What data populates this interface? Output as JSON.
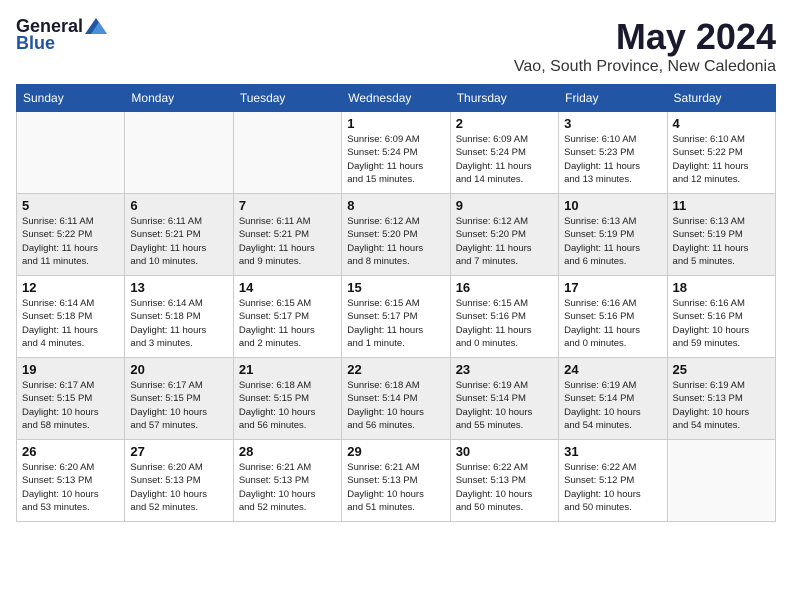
{
  "header": {
    "logo_general": "General",
    "logo_blue": "Blue",
    "month_year": "May 2024",
    "location": "Vao, South Province, New Caledonia"
  },
  "days_of_week": [
    "Sunday",
    "Monday",
    "Tuesday",
    "Wednesday",
    "Thursday",
    "Friday",
    "Saturday"
  ],
  "weeks": [
    [
      {
        "day": "",
        "info": ""
      },
      {
        "day": "",
        "info": ""
      },
      {
        "day": "",
        "info": ""
      },
      {
        "day": "1",
        "info": "Sunrise: 6:09 AM\nSunset: 5:24 PM\nDaylight: 11 hours\nand 15 minutes."
      },
      {
        "day": "2",
        "info": "Sunrise: 6:09 AM\nSunset: 5:24 PM\nDaylight: 11 hours\nand 14 minutes."
      },
      {
        "day": "3",
        "info": "Sunrise: 6:10 AM\nSunset: 5:23 PM\nDaylight: 11 hours\nand 13 minutes."
      },
      {
        "day": "4",
        "info": "Sunrise: 6:10 AM\nSunset: 5:22 PM\nDaylight: 11 hours\nand 12 minutes."
      }
    ],
    [
      {
        "day": "5",
        "info": "Sunrise: 6:11 AM\nSunset: 5:22 PM\nDaylight: 11 hours\nand 11 minutes."
      },
      {
        "day": "6",
        "info": "Sunrise: 6:11 AM\nSunset: 5:21 PM\nDaylight: 11 hours\nand 10 minutes."
      },
      {
        "day": "7",
        "info": "Sunrise: 6:11 AM\nSunset: 5:21 PM\nDaylight: 11 hours\nand 9 minutes."
      },
      {
        "day": "8",
        "info": "Sunrise: 6:12 AM\nSunset: 5:20 PM\nDaylight: 11 hours\nand 8 minutes."
      },
      {
        "day": "9",
        "info": "Sunrise: 6:12 AM\nSunset: 5:20 PM\nDaylight: 11 hours\nand 7 minutes."
      },
      {
        "day": "10",
        "info": "Sunrise: 6:13 AM\nSunset: 5:19 PM\nDaylight: 11 hours\nand 6 minutes."
      },
      {
        "day": "11",
        "info": "Sunrise: 6:13 AM\nSunset: 5:19 PM\nDaylight: 11 hours\nand 5 minutes."
      }
    ],
    [
      {
        "day": "12",
        "info": "Sunrise: 6:14 AM\nSunset: 5:18 PM\nDaylight: 11 hours\nand 4 minutes."
      },
      {
        "day": "13",
        "info": "Sunrise: 6:14 AM\nSunset: 5:18 PM\nDaylight: 11 hours\nand 3 minutes."
      },
      {
        "day": "14",
        "info": "Sunrise: 6:15 AM\nSunset: 5:17 PM\nDaylight: 11 hours\nand 2 minutes."
      },
      {
        "day": "15",
        "info": "Sunrise: 6:15 AM\nSunset: 5:17 PM\nDaylight: 11 hours\nand 1 minute."
      },
      {
        "day": "16",
        "info": "Sunrise: 6:15 AM\nSunset: 5:16 PM\nDaylight: 11 hours\nand 0 minutes."
      },
      {
        "day": "17",
        "info": "Sunrise: 6:16 AM\nSunset: 5:16 PM\nDaylight: 11 hours\nand 0 minutes."
      },
      {
        "day": "18",
        "info": "Sunrise: 6:16 AM\nSunset: 5:16 PM\nDaylight: 10 hours\nand 59 minutes."
      }
    ],
    [
      {
        "day": "19",
        "info": "Sunrise: 6:17 AM\nSunset: 5:15 PM\nDaylight: 10 hours\nand 58 minutes."
      },
      {
        "day": "20",
        "info": "Sunrise: 6:17 AM\nSunset: 5:15 PM\nDaylight: 10 hours\nand 57 minutes."
      },
      {
        "day": "21",
        "info": "Sunrise: 6:18 AM\nSunset: 5:15 PM\nDaylight: 10 hours\nand 56 minutes."
      },
      {
        "day": "22",
        "info": "Sunrise: 6:18 AM\nSunset: 5:14 PM\nDaylight: 10 hours\nand 56 minutes."
      },
      {
        "day": "23",
        "info": "Sunrise: 6:19 AM\nSunset: 5:14 PM\nDaylight: 10 hours\nand 55 minutes."
      },
      {
        "day": "24",
        "info": "Sunrise: 6:19 AM\nSunset: 5:14 PM\nDaylight: 10 hours\nand 54 minutes."
      },
      {
        "day": "25",
        "info": "Sunrise: 6:19 AM\nSunset: 5:13 PM\nDaylight: 10 hours\nand 54 minutes."
      }
    ],
    [
      {
        "day": "26",
        "info": "Sunrise: 6:20 AM\nSunset: 5:13 PM\nDaylight: 10 hours\nand 53 minutes."
      },
      {
        "day": "27",
        "info": "Sunrise: 6:20 AM\nSunset: 5:13 PM\nDaylight: 10 hours\nand 52 minutes."
      },
      {
        "day": "28",
        "info": "Sunrise: 6:21 AM\nSunset: 5:13 PM\nDaylight: 10 hours\nand 52 minutes."
      },
      {
        "day": "29",
        "info": "Sunrise: 6:21 AM\nSunset: 5:13 PM\nDaylight: 10 hours\nand 51 minutes."
      },
      {
        "day": "30",
        "info": "Sunrise: 6:22 AM\nSunset: 5:13 PM\nDaylight: 10 hours\nand 50 minutes."
      },
      {
        "day": "31",
        "info": "Sunrise: 6:22 AM\nSunset: 5:12 PM\nDaylight: 10 hours\nand 50 minutes."
      },
      {
        "day": "",
        "info": ""
      }
    ]
  ]
}
